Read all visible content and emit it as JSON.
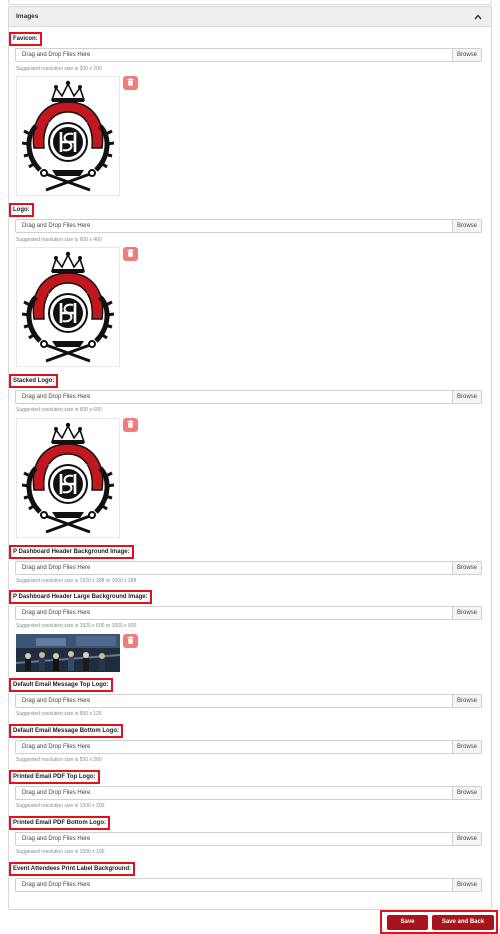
{
  "panel": {
    "title": "Images",
    "collapse_icon": "chevron-up-icon"
  },
  "common": {
    "drop_placeholder": "Drag and Drop Files Here",
    "browse_label": "Browse",
    "delete_icon": "trash-icon"
  },
  "fields": [
    {
      "label": "Favicon:",
      "hint": "Suggested resolution size is 200 x 200",
      "has_preview": true,
      "preview_type": "crest-logo"
    },
    {
      "label": "Logo:",
      "hint": "Suggested resolution size is 600 x 400",
      "has_preview": true,
      "preview_type": "crest-logo"
    },
    {
      "label": "Stacked Logo:",
      "hint": "Suggested resolution size is 600 x 600",
      "has_preview": true,
      "preview_type": "crest-logo"
    },
    {
      "label": "P Dashboard Header Background Image:",
      "hint": "Suggested resolution size is 1920 x 288 or 1600 x 288",
      "has_preview": false
    },
    {
      "label": "P Dashboard Header Large Background Image:",
      "hint": "Suggested resolution size is 1920 x 600 or 1600 x 600",
      "has_preview": true,
      "preview_type": "photo"
    },
    {
      "label": "Default Email Message Top Logo:",
      "hint": "Suggested resolution size is 550 x 125",
      "has_preview": false
    },
    {
      "label": "Default Email Message Bottom Logo:",
      "hint": "Suggested resolution size is 550 x 200",
      "has_preview": false
    },
    {
      "label": "Printed Email PDF Top Logo:",
      "hint": "Suggested resolution size is 1500 x 200",
      "has_preview": false
    },
    {
      "label": "Printed Email PDF Bottom Logo:",
      "hint": "Suggested resolution size is 1500 x 100",
      "has_preview": false
    },
    {
      "label": "Event Attendees Print Label Background:",
      "hint": "",
      "has_preview": false
    }
  ],
  "actions": {
    "save_label": "Save",
    "save_and_back_label": "Save and Back"
  },
  "colors": {
    "highlight": "#e1121f",
    "primary_button": "#a8141c",
    "delete_button": "#f07c7c"
  }
}
